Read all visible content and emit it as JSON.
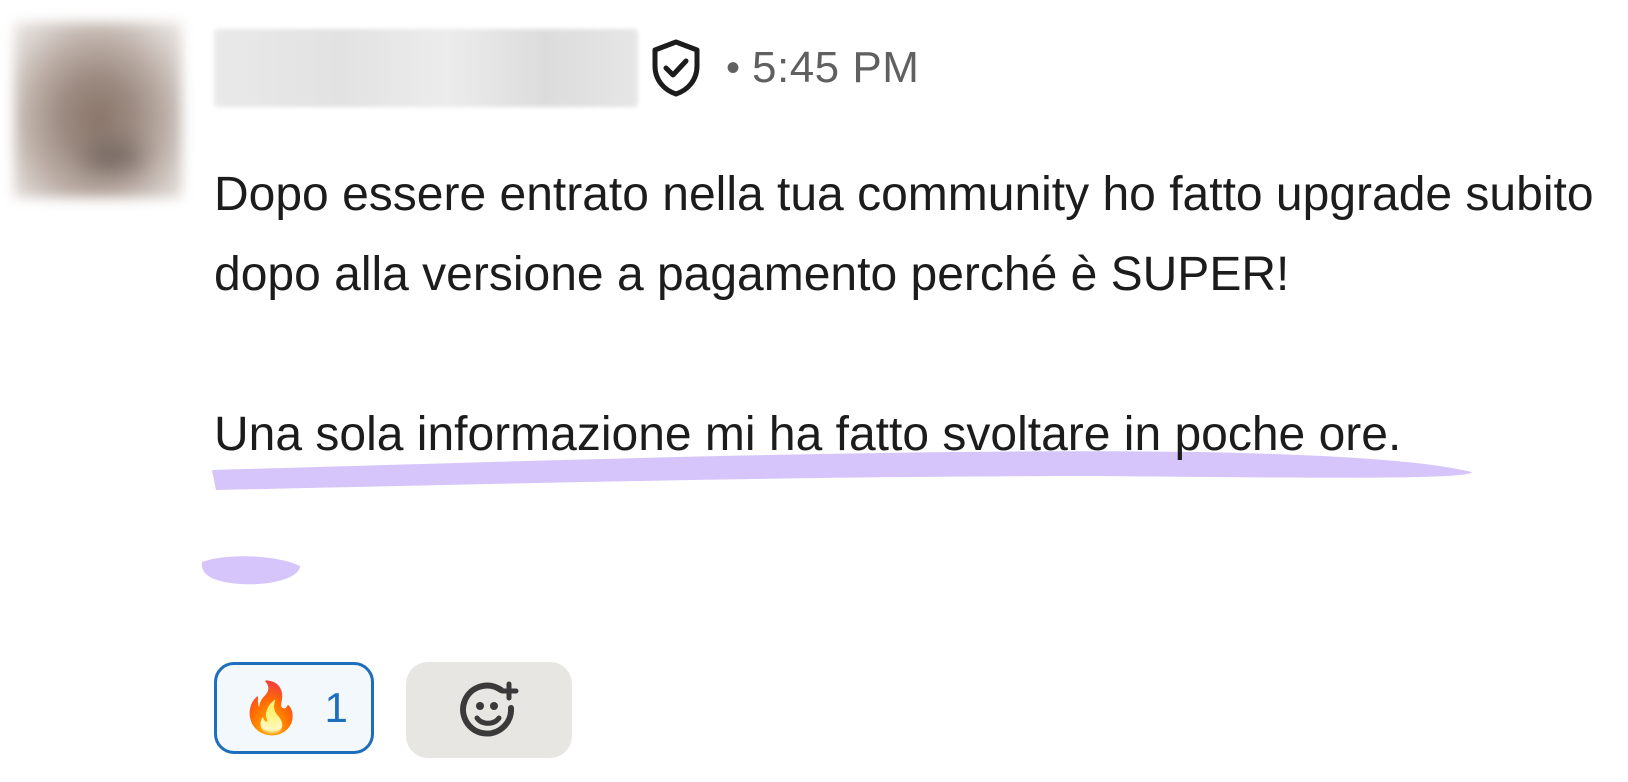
{
  "message": {
    "author_name": "",
    "verified_icon": "shield-check-icon",
    "separator": "•",
    "timestamp": "5:45 PM",
    "paragraph_1": "Dopo essere entrato nella tua community ho fatto upgrade subito dopo alla versione a pagamento perché è SUPER!",
    "paragraph_2": "Una sola informazione mi ha fatto svoltare in poche ore.",
    "highlight_color": "#d4c2fb"
  },
  "reactions": [
    {
      "emoji": "🔥",
      "icon": "fire-emoji",
      "count": "1",
      "accent": "#1d6fbd"
    }
  ],
  "add_reaction_icon": "add-emoji-icon"
}
